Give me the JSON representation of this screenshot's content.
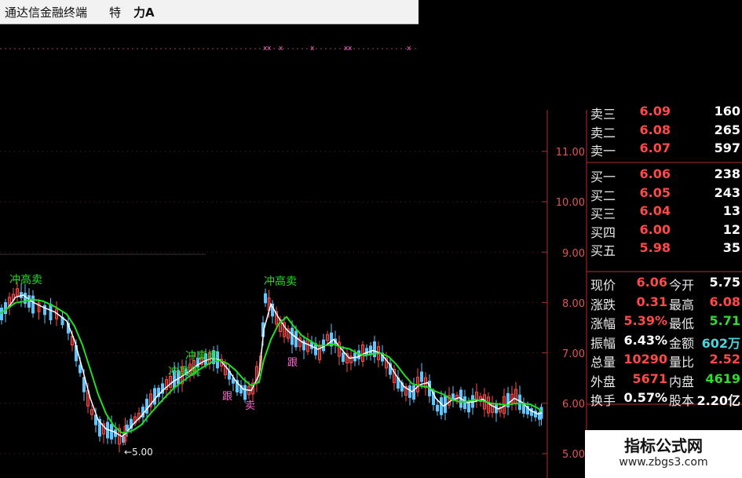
{
  "window": {
    "title": "通达信金融终端",
    "menu1": "特",
    "menu2": "力A"
  },
  "chart_data": {
    "type": "line",
    "y_ticks": [
      "11.00",
      "10.00",
      "9.00",
      "8.00",
      "7.00",
      "6.00",
      "5.00"
    ],
    "low_marker": "←5.00",
    "annotations": [
      "冲高卖",
      "冲高卖",
      "冲高卖",
      "冲高卖",
      "跟",
      "跟",
      "卖"
    ],
    "colors": {
      "up": "#ff4848",
      "down": "#5fc6ff",
      "ma1": "#ffffff",
      "ma2": "#22dd22",
      "axis": "#b03030"
    }
  },
  "orderbook": {
    "sells": [
      {
        "label": "卖三",
        "price": "6.09",
        "vol": "160"
      },
      {
        "label": "卖二",
        "price": "6.08",
        "vol": "265"
      },
      {
        "label": "卖一",
        "price": "6.07",
        "vol": "597"
      }
    ],
    "buys": [
      {
        "label": "买一",
        "price": "6.06",
        "vol": "238"
      },
      {
        "label": "买二",
        "price": "6.05",
        "vol": "243"
      },
      {
        "label": "买三",
        "price": "6.04",
        "vol": "13"
      },
      {
        "label": "买四",
        "price": "6.00",
        "vol": "12"
      },
      {
        "label": "买五",
        "price": "5.98",
        "vol": "35"
      }
    ]
  },
  "stats": [
    {
      "l1": "现价",
      "v1": "6.06",
      "l2": "今开",
      "v2": "5.75"
    },
    {
      "l1": "涨跌",
      "v1": "0.31",
      "l2": "最高",
      "v2": "6.08"
    },
    {
      "l1": "涨幅",
      "v1": "5.39%",
      "l2": "最低",
      "v2": "5.71"
    },
    {
      "l1": "振幅",
      "v1": "6.43%",
      "l2": "金额",
      "v2": "602万"
    },
    {
      "l1": "总量",
      "v1": "10290",
      "l2": "量比",
      "v2": "2.52"
    },
    {
      "l1": "外盘",
      "v1": "5671",
      "l2": "内盘",
      "v2": "4619"
    },
    {
      "l1": "换手",
      "v1": "0.57%",
      "l2": "股本",
      "v2": "2.20亿"
    }
  ],
  "watermark": {
    "line1": "指标公式网",
    "line2": "www.zbgs3.com"
  }
}
